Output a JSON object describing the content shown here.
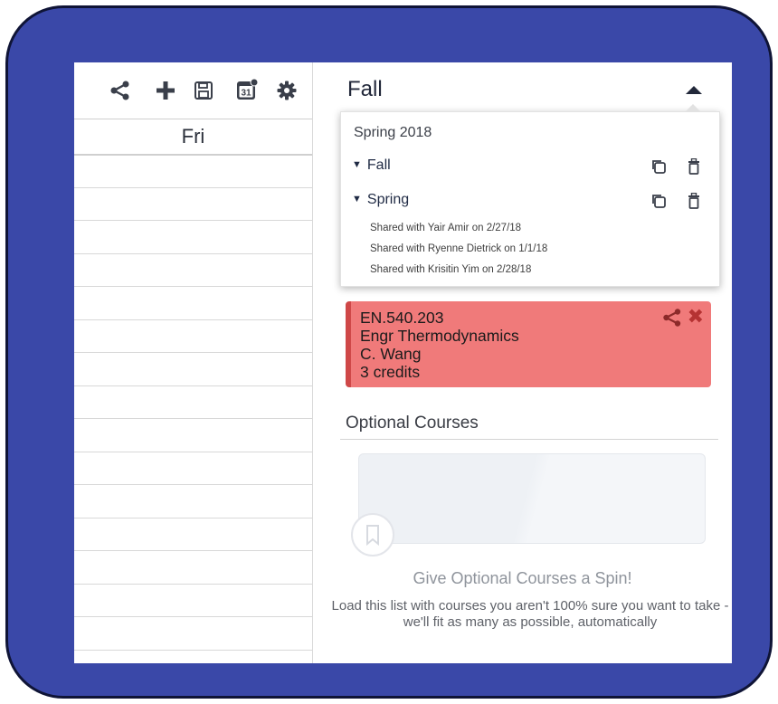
{
  "toolbar": {
    "icons": [
      "share-icon",
      "plus-icon",
      "save-icon",
      "calendar-icon",
      "gear-icon"
    ],
    "calendar_day_badge": "31"
  },
  "calendar": {
    "day_header": "Fri"
  },
  "semester": {
    "current": "Fall"
  },
  "dropdown": {
    "header": "Spring 2018",
    "semesters": [
      {
        "name": "Fall",
        "actions": [
          "duplicate-icon",
          "trash-icon"
        ]
      },
      {
        "name": "Spring",
        "actions": [
          "duplicate-icon",
          "trash-icon"
        ]
      }
    ],
    "shares": [
      "Shared with Yair Amir on 2/27/18",
      "Shared with Ryenne Dietrick on 1/1/18",
      "Shared with Krisitin Yim on 2/28/18"
    ]
  },
  "course_card": {
    "code": "EN.540.203",
    "title": "Engr Thermodynamics",
    "instructor": "C. Wang",
    "credits": "3 credits",
    "close_symbol": "✖",
    "color": "#f07a7a"
  },
  "optional": {
    "title": "Optional Courses",
    "heading": "Give Optional Courses a Spin!",
    "description": "Load this list with courses you aren't 100% sure you want to take - we'll fit as many as possible, automatically"
  },
  "colors": {
    "frame": "#3a48a8",
    "text_dark": "#22283a"
  }
}
